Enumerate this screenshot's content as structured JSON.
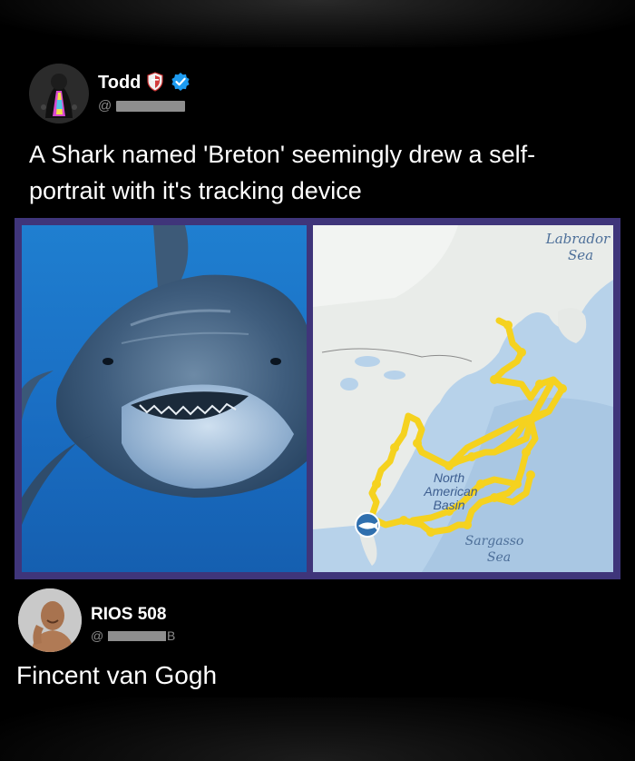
{
  "tweet": {
    "author": {
      "display_name": "Todd",
      "handle_prefix": "@",
      "badges": [
        "shield-icon",
        "verified-icon"
      ],
      "verified_color": "#1d9bf0"
    },
    "text": "A Shark named 'Breton' seemingly drew a self-portrait with it's tracking device"
  },
  "media": {
    "map_labels": {
      "labrador_line1": "Labrador",
      "labrador_line2": "Sea",
      "basin_line1": "North",
      "basin_line2": "American",
      "basin_line3": "Basin",
      "sargasso_line1": "Sargasso",
      "sargasso_line2": "Sea"
    },
    "track_color": "#f5d21f",
    "frame_color": "#3f357a"
  },
  "reply": {
    "display_name": "RIOS 508",
    "handle_prefix": "@",
    "handle_suffix": "B",
    "text": "Fincent van Gogh"
  }
}
